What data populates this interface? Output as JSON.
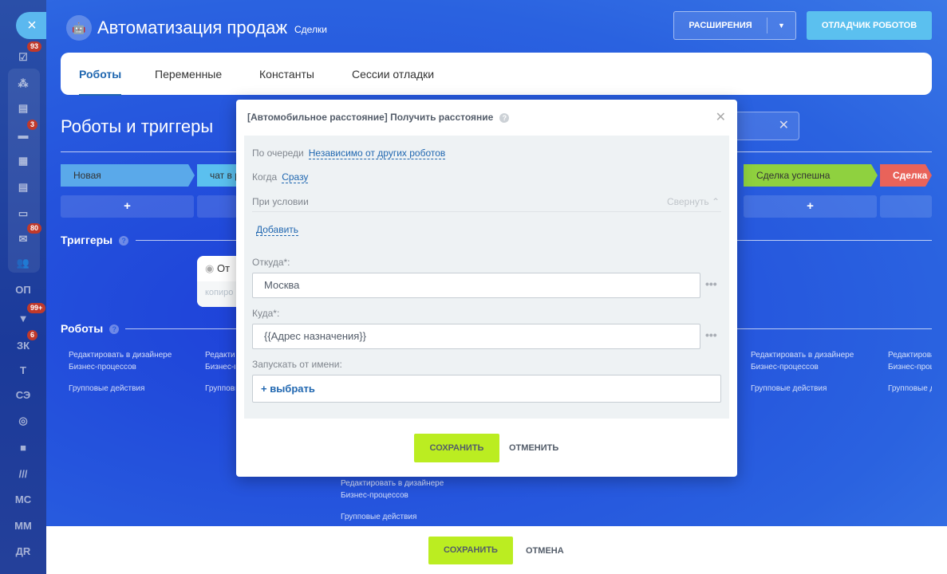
{
  "sidebar": {
    "close": "×",
    "items": [
      {
        "icon": "tasks-icon",
        "badge": "93"
      },
      {
        "icon": "crm-icon"
      },
      {
        "icon": "feed-icon"
      },
      {
        "icon": "chat-icon",
        "badge": "3"
      },
      {
        "icon": "calendar-icon"
      },
      {
        "icon": "document-icon"
      },
      {
        "icon": "drive-icon"
      },
      {
        "icon": "mail-icon",
        "badge": "80"
      },
      {
        "icon": "groups-icon"
      },
      {
        "label": "ОП"
      },
      {
        "icon": "filter-icon",
        "badge": "99+"
      },
      {
        "label": "ЗК",
        "badge": "6"
      },
      {
        "label": "Т"
      },
      {
        "label": "СЭ"
      },
      {
        "icon": "target-icon"
      },
      {
        "icon": "box-icon"
      },
      {
        "icon": "logo-m-icon"
      },
      {
        "label": "МС"
      },
      {
        "label": "ММ"
      },
      {
        "label": "ДR"
      }
    ]
  },
  "header": {
    "title": "Автоматизация продаж",
    "subtitle": "Сделки",
    "extensions": "РАСШИРЕНИЯ",
    "debugger": "ОТЛАДЧИК РОБОТОВ"
  },
  "tabs": [
    "Роботы",
    "Переменные",
    "Константы",
    "Сессии отладки"
  ],
  "section_title": "Роботы и триггеры",
  "stages": [
    {
      "label": "Новая",
      "color": "#5aa9ea",
      "text": "#333"
    },
    {
      "label": "чат в р",
      "color": "#5bc0ef",
      "text": "#333"
    },
    {
      "label": "Сделка успешна",
      "color": "#8fd13f",
      "text": "#333"
    },
    {
      "label": "Сделка п",
      "color": "#e9635a",
      "text": "#fff"
    }
  ],
  "plus": "+",
  "triggers_title": "Триггеры",
  "trigger_card": {
    "title": "От",
    "subtitle": "копиро"
  },
  "robots_title": "Роботы",
  "links": {
    "edit": "Редактировать в дизайнере",
    "edit2": "Бизнес-процессов",
    "group": "Групповые действия"
  },
  "footer": {
    "save": "СОХРАНИТЬ",
    "cancel": "ОТМЕНА"
  },
  "modal": {
    "title": "[Автомобильное расстояние] Получить расстояние",
    "order_label": "По очереди",
    "order_value": "Независимо от других роботов",
    "when_label": "Когда",
    "when_value": "Сразу",
    "condition_label": "При условии",
    "collapse": "Свернуть",
    "add": "Добавить",
    "from_label": "Откуда*:",
    "from_value": "Москва",
    "to_label": "Куда*:",
    "to_value": "{{Адрес назначения}}",
    "run_as_label": "Запускать от имени:",
    "choose": "+ выбрать",
    "save": "СОХРАНИТЬ",
    "cancel": "ОТМЕНИТЬ"
  }
}
